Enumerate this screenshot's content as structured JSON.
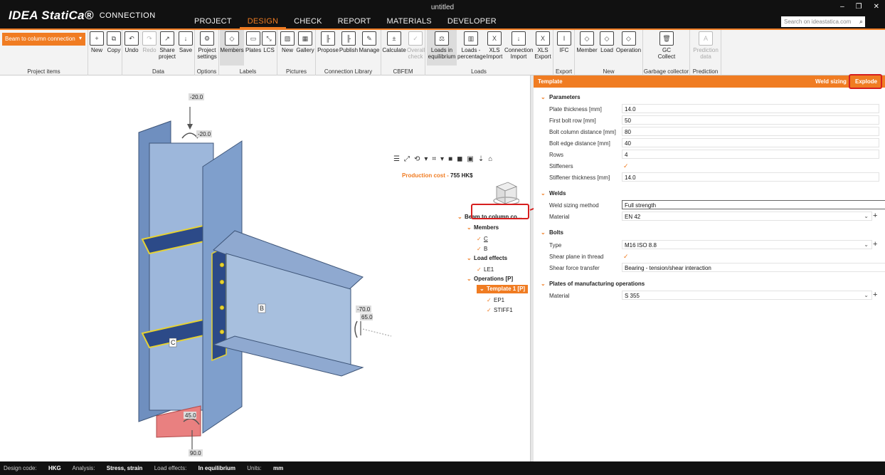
{
  "app": {
    "brand": "IDEA StatiCa®",
    "subtitle": "CONNECTION",
    "window_title": "untitled",
    "tabs": [
      "PROJECT",
      "DESIGN",
      "CHECK",
      "REPORT",
      "MATERIALS",
      "DEVELOPER"
    ],
    "active_tab": "DESIGN",
    "search_placeholder": "Search on ideastatica.com"
  },
  "ribbon": {
    "project_dropdown": "Beam to column connection",
    "groups": {
      "project_items": "Project items",
      "data": "Data",
      "options": "Options",
      "labels": "Labels",
      "pictures": "Pictures",
      "connection_library": "Connection Library",
      "cbfem": "CBFEM",
      "loads": "Loads",
      "export": "Export",
      "new": "New",
      "gc": "Garbage collector",
      "prediction": "Prediction"
    },
    "buttons": {
      "new": "New",
      "copy": "Copy",
      "undo": "Undo",
      "redo": "Redo",
      "share": "Share project",
      "save": "Save",
      "settings": "Project settings",
      "members": "Members",
      "plates": "Plates",
      "lcs": "LCS",
      "pic_new": "New",
      "gallery": "Gallery",
      "propose": "Propose",
      "publish": "Publish",
      "manage": "Manage",
      "calculate": "Calculate",
      "overall_check": "Overall check",
      "loads_eq": "Loads in equilibrium",
      "loads_pct": "Loads - percentage",
      "xls_import": "XLS Import",
      "conn_import": "Connection Import",
      "xls_export": "XLS Export",
      "ifc": "IFC",
      "member": "Member",
      "load": "Load",
      "operation": "Operation",
      "gc_collect": "GC Collect",
      "prediction_data": "Prediction data"
    }
  },
  "viewport": {
    "production_cost_label": "Production cost",
    "production_cost_value": "755 HK$",
    "labels": {
      "top_force": "-20.0",
      "top_moment": "-20.0",
      "right_force": "-70.0",
      "right_moment": "65.0",
      "bottom_moment": "45.0",
      "bottom_force": "90.0",
      "member_b": "B",
      "member_c": "C"
    },
    "tree": {
      "root": "Beam to column co...",
      "members": "Members",
      "member_c": "C",
      "member_b": "B",
      "load_effects": "Load effects",
      "le1": "LE1",
      "operations": "Operations [P]",
      "template": "Template 1 [P]",
      "ep1": "EP1",
      "stiff1": "STIFF1"
    }
  },
  "panel": {
    "title": "Template",
    "weld_sizing": "Weld sizing",
    "explode": "Explode",
    "parameters": {
      "title": "Parameters",
      "plate_thickness_label": "Plate thickness [mm]",
      "plate_thickness": "14.0",
      "first_bolt_row_label": "First bolt row [mm]",
      "first_bolt_row": "50",
      "bolt_col_dist_label": "Bolt column distance [mm]",
      "bolt_col_dist": "80",
      "bolt_edge_dist_label": "Bolt edge distance [mm]",
      "bolt_edge_dist": "40",
      "rows_label": "Rows",
      "rows": "4",
      "stiffeners_label": "Stiffeners",
      "stiffener_thickness_label": "Stiffener thickness [mm]",
      "stiffener_thickness": "14.0"
    },
    "welds": {
      "title": "Welds",
      "method_label": "Weld sizing method",
      "method": "Full strength",
      "material_label": "Material",
      "material": "EN 42"
    },
    "bolts": {
      "title": "Bolts",
      "type_label": "Type",
      "type": "M16 ISO 8.8",
      "shear_plane_label": "Shear plane in thread",
      "shear_force_label": "Shear force transfer",
      "shear_force": "Bearing - tension/shear interaction"
    },
    "plates": {
      "title": "Plates of manufacturing operations",
      "material_label": "Material",
      "material": "S 355"
    }
  },
  "status": {
    "design_code_label": "Design code:",
    "design_code": "HKG",
    "analysis_label": "Analysis:",
    "analysis": "Stress, strain",
    "load_effects_label": "Load effects:",
    "load_effects": "In equilibrium",
    "units_label": "Units:",
    "units": "mm"
  },
  "colors": {
    "accent": "#f07c22",
    "highlight": "#d61f1f",
    "steel": "#7b9cc8"
  }
}
